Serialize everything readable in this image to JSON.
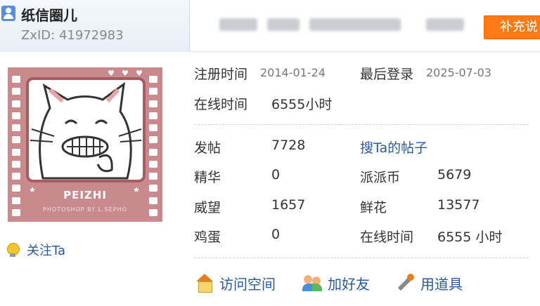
{
  "header": {
    "username": "纸信圈儿",
    "zxid": "ZxID: 41972983",
    "recharge_label": "补充说"
  },
  "avatar": {
    "caption": "PEIZHI",
    "credit": "PHOTOSHOP BY L.SEPHO"
  },
  "follow_label": "关注Ta",
  "registration": {
    "label": "注册时间",
    "value": "2014-01-24"
  },
  "last_login": {
    "label": "最后登录",
    "value": "2025-07-03"
  },
  "online_time_top": {
    "label": "在线时间",
    "value": "6555小时"
  },
  "stats": {
    "posts_label": "发帖",
    "posts_value": "7728",
    "search_posts_link": "搜Ta的帖子",
    "digest_label": "精华",
    "digest_value": "0",
    "paipai_label": "派派币",
    "paipai_value": "5679",
    "prestige_label": "威望",
    "prestige_value": "1657",
    "flowers_label": "鲜花",
    "flowers_value": "13577",
    "eggs_label": "鸡蛋",
    "eggs_value": "0",
    "online_label": "在线时间",
    "online_value": "6555 小时"
  },
  "actions": {
    "visit_space": "访问空间",
    "add_friend": "加好友",
    "use_items": "用道具"
  },
  "icons": {
    "user": "user-icon",
    "follow": "lightbulb-icon",
    "visit": "home-icon",
    "friend": "add-friend-icon",
    "tools": "wand-icon"
  },
  "colors": {
    "link": "#2a5a9c",
    "recharge_button": "#ff7a14",
    "avatar_background": "#c98a8e"
  }
}
